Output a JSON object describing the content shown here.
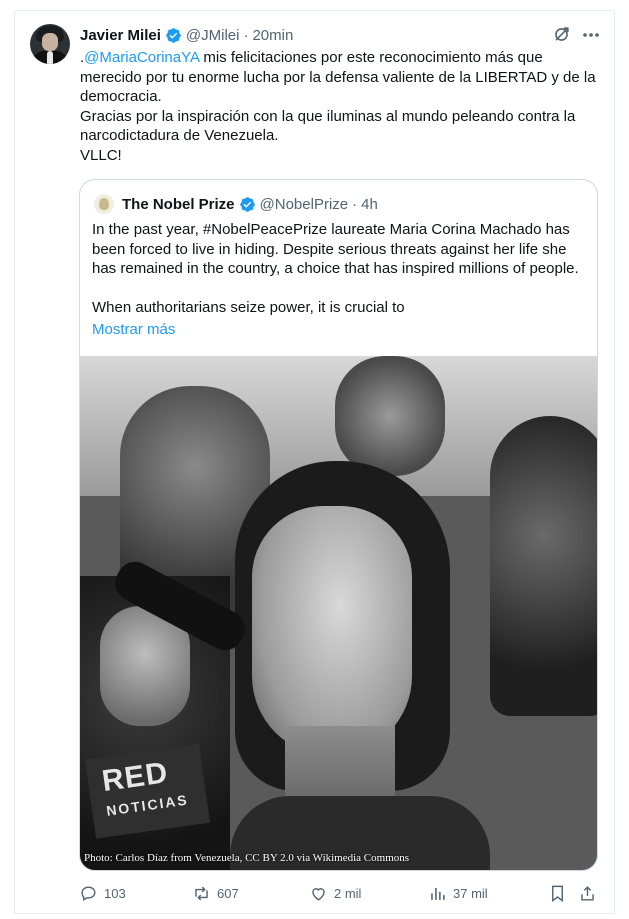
{
  "author": {
    "name": "Javier Milei",
    "handle": "@JMilei",
    "separator": "·",
    "time": "20min"
  },
  "tweet": {
    "prefix": ".",
    "mention": "@MariaCorinaYA",
    "line1_rest": " mis felicitaciones por este reconocimiento más que merecido por tu enorme lucha por la defensa valiente de la LIBERTAD y de la democracia.",
    "line2": "Gracias por la inspiración con la que iluminas al mundo peleando contra la narcodictadura de Venezuela.",
    "line3": "VLLC!"
  },
  "quote": {
    "name": "The Nobel Prize",
    "handle": "@NobelPrize",
    "separator": "·",
    "time": "4h",
    "paragraph1": "In the past year, #NobelPeacePrize laureate Maria Corina Machado has been forced to live in hiding. Despite serious threats against her life she has remained in the country, a choice that has inspired millions of people.",
    "paragraph2": "When authoritarians seize power, it is crucial to",
    "show_more": "Mostrar más",
    "photo": {
      "credit": "Photo: Carlos Díaz from Venezuela, CC BY 2.0 via Wikimedia Commons",
      "sign_logo": "RED",
      "sign_sub": "NOTICIAS"
    }
  },
  "actions": {
    "replies": "103",
    "reposts": "607",
    "likes": "2 mil",
    "views": "37 mil"
  },
  "colors": {
    "link": "#1d9bf0",
    "verified": "#1d9bf0",
    "secondary_text": "#536471",
    "border": "#cfd9de"
  },
  "icons": [
    "verified-badge-icon",
    "grok-icon",
    "more-icon",
    "reply-icon",
    "repost-icon",
    "like-icon",
    "views-icon",
    "bookmark-icon",
    "share-icon"
  ]
}
